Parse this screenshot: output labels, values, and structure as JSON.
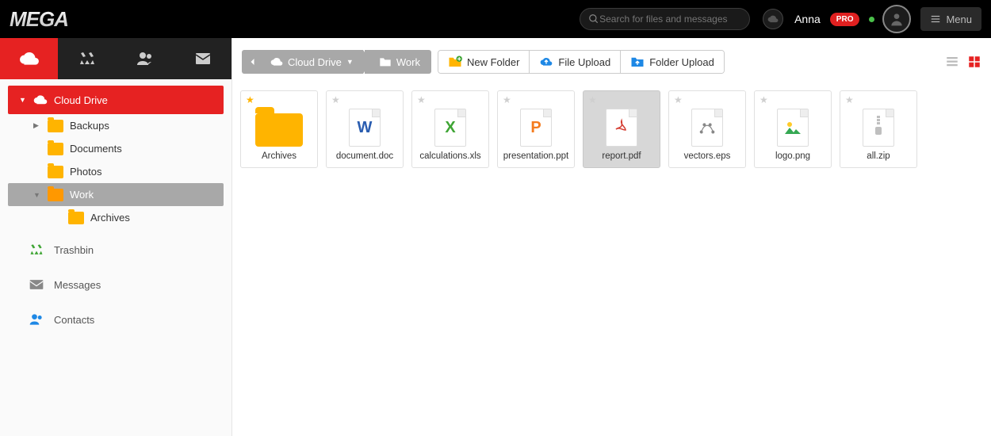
{
  "brand": "MEGA",
  "header": {
    "search_placeholder": "Search for files and messages",
    "username": "Anna",
    "badge": "PRO",
    "menu_label": "Menu"
  },
  "sidebar": {
    "root": "Cloud Drive",
    "folders": [
      {
        "label": "Backups",
        "level": 1,
        "selected": false,
        "arrow": "▶"
      },
      {
        "label": "Documents",
        "level": 1,
        "selected": false,
        "arrow": ""
      },
      {
        "label": "Photos",
        "level": 1,
        "selected": false,
        "arrow": ""
      },
      {
        "label": "Work",
        "level": 1,
        "selected": true,
        "arrow": "▼"
      },
      {
        "label": "Archives",
        "level": 2,
        "selected": false,
        "arrow": ""
      }
    ],
    "sections": [
      {
        "label": "Trashbin",
        "icon": "recycle"
      },
      {
        "label": "Messages",
        "icon": "mail"
      },
      {
        "label": "Contacts",
        "icon": "contacts"
      }
    ]
  },
  "breadcrumb": {
    "root": "Cloud Drive",
    "leaf": "Work"
  },
  "actions": {
    "new_folder": "New Folder",
    "file_upload": "File Upload",
    "folder_upload": "Folder Upload"
  },
  "colors": {
    "doc": "#2a5db0",
    "xls": "#3fa535",
    "ppt": "#f47c20",
    "pdf": "#d43a2f",
    "img": "#35a853",
    "zip": "#bfbfbf",
    "eps": "#888"
  },
  "files": [
    {
      "name": "Archives",
      "type": "folder",
      "star": "gold",
      "selected": false
    },
    {
      "name": "document.doc",
      "type": "doc",
      "star": "grey",
      "selected": false
    },
    {
      "name": "calculations.xls",
      "type": "xls",
      "star": "grey",
      "selected": false
    },
    {
      "name": "presentation.ppt",
      "type": "ppt",
      "star": "grey",
      "selected": false
    },
    {
      "name": "report.pdf",
      "type": "pdf",
      "star": "grey",
      "selected": true
    },
    {
      "name": "vectors.eps",
      "type": "eps",
      "star": "grey",
      "selected": false
    },
    {
      "name": "logo.png",
      "type": "img",
      "star": "grey",
      "selected": false
    },
    {
      "name": "all.zip",
      "type": "zip",
      "star": "grey",
      "selected": false
    }
  ]
}
